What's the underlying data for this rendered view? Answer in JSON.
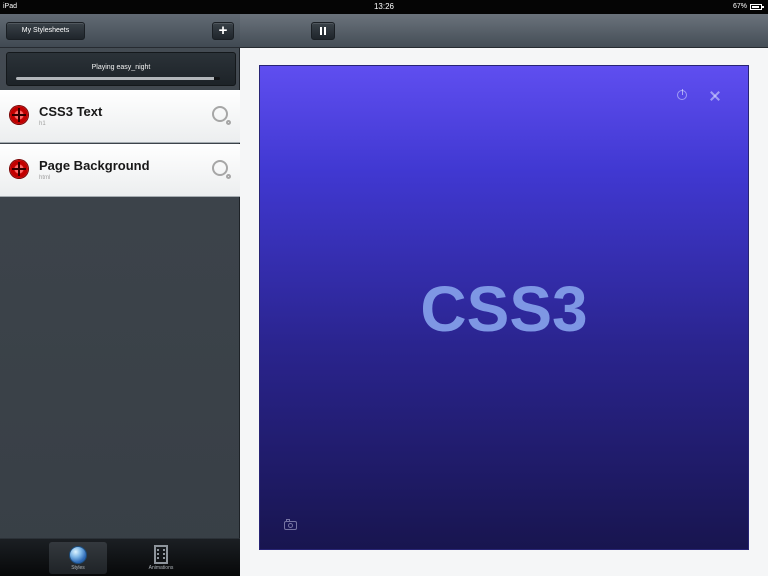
{
  "status_bar": {
    "device": "iPad",
    "time": "13:26",
    "battery": "67%"
  },
  "sidebar": {
    "my_stylesheets": "My Stylesheets",
    "add_label": "+",
    "player": {
      "text": "Playing easy_night",
      "progress_percent": 97
    },
    "styles": [
      {
        "title": "CSS3 Text",
        "subtitle": "h1",
        "status_icon": "record-icon",
        "settings_icon": "settings-icon"
      },
      {
        "title": "Page Background",
        "subtitle": "html",
        "status_icon": "record-icon",
        "settings_icon": "settings-icon"
      }
    ],
    "tabs": [
      {
        "label": "Styles",
        "icon": "globe-icon"
      },
      {
        "label": "Animations",
        "icon": "film-icon"
      }
    ]
  },
  "main": {
    "toolbar_icon": "pause-icon",
    "preview_text": "CSS3",
    "top_icons": [
      "power-icon",
      "fullscreen-icon"
    ],
    "bottom_icon": "camera-icon"
  },
  "colors": {
    "preview_top": "#5F4EF0",
    "preview_bottom": "#18154F",
    "preview_text": "#7E97E4",
    "record": "#C20000"
  }
}
